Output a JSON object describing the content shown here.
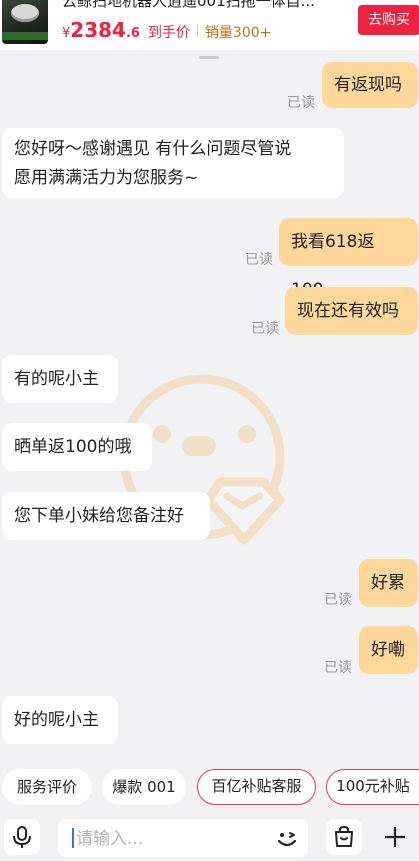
{
  "product": {
    "title": "云鲸扫地机器人逍遥001扫拖一体自...",
    "currency": "¥",
    "price_int": "2384",
    "price_dec": ".6",
    "price_label": "到手价",
    "sales": "销量300+",
    "buy_label": "去购买"
  },
  "messages": [
    {
      "dir": "out",
      "text": "有返现吗",
      "read": "已读"
    },
    {
      "dir": "in",
      "line1": "您好呀～感谢遇见 有什么问题尽管说",
      "line2": "愿用满满活力为您服务~"
    },
    {
      "dir": "out",
      "text": "我看618返100",
      "read": "已读"
    },
    {
      "dir": "out",
      "text": "现在还有效吗",
      "read": "已读"
    },
    {
      "dir": "in",
      "text": "有的呢小主"
    },
    {
      "dir": "in",
      "text": "晒单返100的哦"
    },
    {
      "dir": "in",
      "text": "您下单小妹给您备注好"
    },
    {
      "dir": "out",
      "text": "好累",
      "read": "已读"
    },
    {
      "dir": "out",
      "text": "好嘞",
      "read": "已读"
    },
    {
      "dir": "in",
      "text": "好的呢小主"
    }
  ],
  "quick_replies": [
    {
      "label": "服务评价",
      "style": "plain"
    },
    {
      "label": "爆款 001",
      "style": "plain"
    },
    {
      "label": "百亿补贴客服",
      "style": "red"
    },
    {
      "label": "100元补贴",
      "style": "red"
    }
  ],
  "input": {
    "placeholder": "请输入..."
  },
  "icons": {
    "voice": "microphone-icon",
    "emoji": "emoji-wink-icon",
    "order": "shopping-bag-icon",
    "more": "plus-icon"
  },
  "colors": {
    "accent_red": "#f0203f",
    "bubble_out": "#ffd79a",
    "bubble_in": "#ffffff",
    "background": "#f2f2f4",
    "sales_text": "#b8741a"
  }
}
